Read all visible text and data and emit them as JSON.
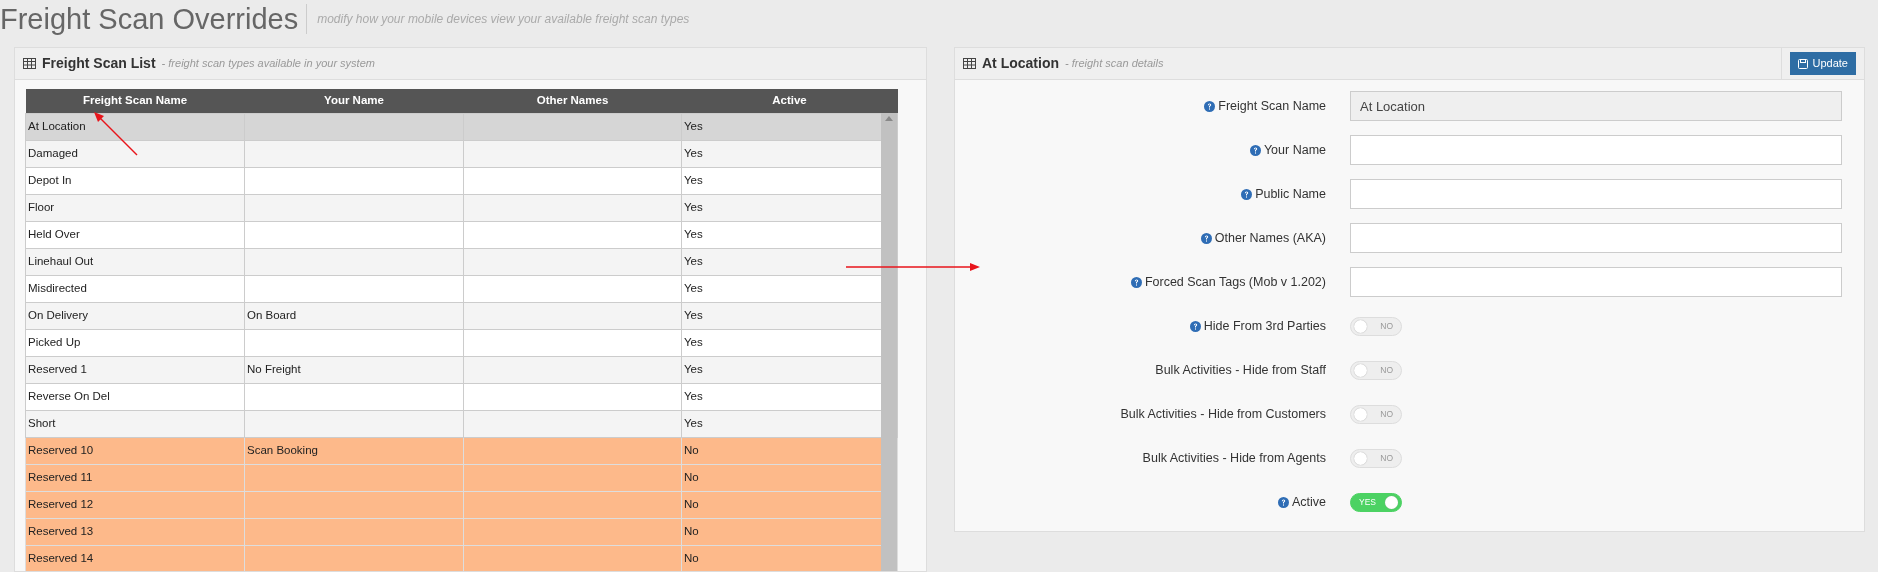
{
  "page": {
    "title": "Freight Scan Overrides",
    "subtitle": "modify how your mobile devices view your available freight scan types"
  },
  "list_panel": {
    "title": "Freight Scan List",
    "subtitle": "- freight scan types available in your system",
    "table": {
      "columns": [
        "Freight Scan Name",
        "Your Name",
        "Other Names",
        "Active"
      ],
      "rows": [
        {
          "cells": [
            "At Location",
            "",
            "",
            "Yes"
          ],
          "selected": true,
          "inactive": false
        },
        {
          "cells": [
            "Damaged",
            "",
            "",
            "Yes"
          ],
          "selected": false,
          "inactive": false
        },
        {
          "cells": [
            "Depot In",
            "",
            "",
            "Yes"
          ],
          "selected": false,
          "inactive": false
        },
        {
          "cells": [
            "Floor",
            "",
            "",
            "Yes"
          ],
          "selected": false,
          "inactive": false
        },
        {
          "cells": [
            "Held Over",
            "",
            "",
            "Yes"
          ],
          "selected": false,
          "inactive": false
        },
        {
          "cells": [
            "Linehaul Out",
            "",
            "",
            "Yes"
          ],
          "selected": false,
          "inactive": false
        },
        {
          "cells": [
            "Misdirected",
            "",
            "",
            "Yes"
          ],
          "selected": false,
          "inactive": false
        },
        {
          "cells": [
            "On Delivery",
            "On Board",
            "",
            "Yes"
          ],
          "selected": false,
          "inactive": false
        },
        {
          "cells": [
            "Picked Up",
            "",
            "",
            "Yes"
          ],
          "selected": false,
          "inactive": false
        },
        {
          "cells": [
            "Reserved 1",
            "No Freight",
            "",
            "Yes"
          ],
          "selected": false,
          "inactive": false
        },
        {
          "cells": [
            "Reverse On Del",
            "",
            "",
            "Yes"
          ],
          "selected": false,
          "inactive": false
        },
        {
          "cells": [
            "Short",
            "",
            "",
            "Yes"
          ],
          "selected": false,
          "inactive": false
        },
        {
          "cells": [
            "Reserved 10",
            "Scan Booking",
            "",
            "No"
          ],
          "selected": false,
          "inactive": true
        },
        {
          "cells": [
            "Reserved 11",
            "",
            "",
            "No"
          ],
          "selected": false,
          "inactive": true
        },
        {
          "cells": [
            "Reserved 12",
            "",
            "",
            "No"
          ],
          "selected": false,
          "inactive": true
        },
        {
          "cells": [
            "Reserved 13",
            "",
            "",
            "No"
          ],
          "selected": false,
          "inactive": true
        },
        {
          "cells": [
            "Reserved 14",
            "",
            "",
            "No"
          ],
          "selected": false,
          "inactive": true
        }
      ]
    }
  },
  "detail_panel": {
    "title": "At Location",
    "subtitle": "- freight scan details",
    "button": "Update",
    "fields": [
      {
        "kind": "text",
        "label": "Freight Scan Name",
        "help": true,
        "value": "At Location",
        "disabled": true
      },
      {
        "kind": "text",
        "label": "Your Name",
        "help": true,
        "disabled": false
      },
      {
        "kind": "text",
        "label": "Public Name",
        "help": true,
        "disabled": false
      },
      {
        "kind": "text",
        "label": "Other Names (AKA)",
        "help": true,
        "disabled": false
      },
      {
        "kind": "text",
        "label": "Forced Scan Tags (Mob v 1.202)",
        "help": true,
        "disabled": false
      },
      {
        "kind": "toggle",
        "label": "Hide From 3rd Parties",
        "help": true,
        "on": false,
        "text": "NO"
      },
      {
        "kind": "toggle",
        "label": "Bulk Activities - Hide from Staff",
        "help": false,
        "on": false,
        "text": "NO"
      },
      {
        "kind": "toggle",
        "label": "Bulk Activities - Hide from Customers",
        "help": false,
        "on": false,
        "text": "NO"
      },
      {
        "kind": "toggle",
        "label": "Bulk Activities - Hide from Agents",
        "help": false,
        "on": false,
        "text": "NO"
      },
      {
        "kind": "toggle",
        "label": "Active",
        "help": true,
        "on": true,
        "text": "YES"
      }
    ]
  }
}
